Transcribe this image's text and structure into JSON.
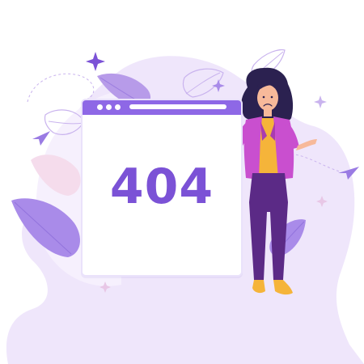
{
  "error_screen": {
    "code": "404"
  },
  "colors": {
    "background_blob": "#efe6fb",
    "blob_light": "#f6f0fd",
    "window_titlebar": "#8e68e6",
    "error_text": "#7b52d6",
    "leaf_purple": "#a98be9",
    "leaf_pink": "#f5dcec",
    "jacket": "#c94fcf",
    "shirt": "#f5b43a",
    "pants": "#5b2a86",
    "hair": "#2b2150",
    "skin": "#f7b99a",
    "sparkle": "#7b52d6"
  },
  "icons": [
    "sparkle-icon",
    "paper-plane-icon",
    "leaf-icon",
    "window-dots-icon"
  ]
}
